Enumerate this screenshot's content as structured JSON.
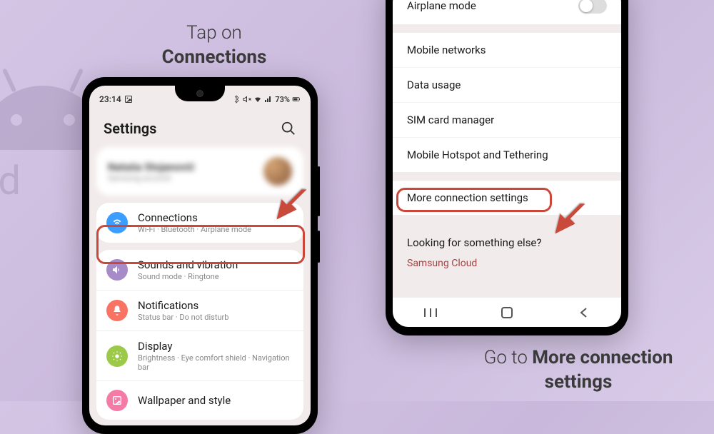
{
  "captions": {
    "left_line1": "Tap on",
    "left_line2": "Connections",
    "right_line1": "Go to ",
    "right_line2_bold": "More connection settings"
  },
  "android_bg_text": "and",
  "phone_left": {
    "status": {
      "time": "23:14",
      "battery": "73%"
    },
    "header": {
      "title": "Settings"
    },
    "account": {
      "name": "Nataša Stojanović",
      "sub": "Samsung account"
    },
    "items": [
      {
        "title": "Connections",
        "sub": "Wi-Fi · Bluetooth · Airplane mode",
        "icon": "wifi",
        "color": "icon-blue"
      },
      {
        "title": "Sounds and vibration",
        "sub": "Sound mode · Ringtone",
        "icon": "sound",
        "color": "icon-purple"
      },
      {
        "title": "Notifications",
        "sub": "Status bar · Do not disturb",
        "icon": "bell",
        "color": "icon-red"
      },
      {
        "title": "Display",
        "sub": "Brightness · Eye comfort shield · Navigation bar",
        "icon": "sun",
        "color": "icon-green"
      },
      {
        "title": "Wallpaper and style",
        "sub": "",
        "icon": "wallpaper",
        "color": "icon-pink"
      }
    ]
  },
  "phone_right": {
    "rows": {
      "airplane": "Airplane mode",
      "mobile_networks": "Mobile networks",
      "data_usage": "Data usage",
      "sim": "SIM card manager",
      "hotspot": "Mobile Hotspot and Tethering",
      "more": "More connection settings",
      "looking": "Looking for something else?",
      "samsung_cloud": "Samsung Cloud"
    }
  }
}
